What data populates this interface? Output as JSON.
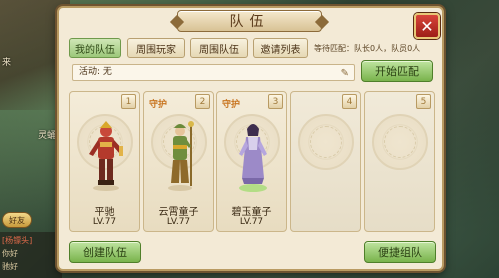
{
  "background": {
    "left_text_1": "来",
    "left_text_2": "灵蛹",
    "side_chip": "好友",
    "chat_line_1": "[杨镖头]",
    "chat_line_2": "你好",
    "chat_line_3": "驰好"
  },
  "window": {
    "title": "队伍",
    "close": "✕"
  },
  "tabs": [
    {
      "label": "我的队伍",
      "active": true
    },
    {
      "label": "周围玩家",
      "active": false
    },
    {
      "label": "周围队伍",
      "active": false
    },
    {
      "label": "邀请列表",
      "active": false
    }
  ],
  "queue_info": "等待匹配：队长0人，队员0人",
  "activity": {
    "label": "活动: 无",
    "icon": "edit-icon"
  },
  "start_match_button": "开始匹配",
  "slots": [
    {
      "num": "1",
      "tag": "",
      "name": "平驰",
      "level": "LV.77",
      "filled": true
    },
    {
      "num": "2",
      "tag": "守护",
      "name": "云霄童子",
      "level": "LV.77",
      "filled": true
    },
    {
      "num": "3",
      "tag": "守护",
      "name": "碧玉童子",
      "level": "LV.77",
      "filled": true
    },
    {
      "num": "4",
      "tag": "",
      "name": "",
      "level": "",
      "filled": false
    },
    {
      "num": "5",
      "tag": "",
      "name": "",
      "level": "",
      "filled": false
    }
  ],
  "create_team_button": "创建队伍",
  "quick_team_button": "便捷组队",
  "colors": {
    "accent_green": "#79b34c",
    "panel_bg": "#f3ead6",
    "close_red": "#c8332a",
    "guard_orange": "#c8741f"
  }
}
